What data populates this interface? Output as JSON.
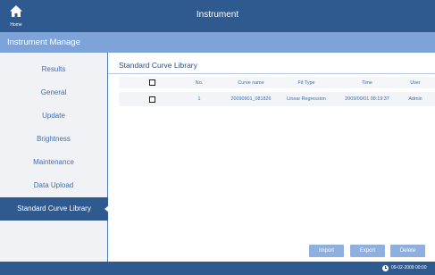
{
  "header": {
    "title": "Instrument",
    "home_label": "Home"
  },
  "section": {
    "title": "Instrument Manage"
  },
  "sidebar": {
    "items": [
      {
        "label": "Results"
      },
      {
        "label": "General"
      },
      {
        "label": "Update"
      },
      {
        "label": "Brightness"
      },
      {
        "label": "Maintenance"
      },
      {
        "label": "Data Upload"
      },
      {
        "label": "Standard Curve Library"
      }
    ],
    "active_index": 6
  },
  "main": {
    "title": "Standard Curve Library",
    "table": {
      "columns": [
        "No.",
        "Curve name",
        "Fit Type",
        "Time",
        "User"
      ],
      "rows": [
        {
          "no": "1",
          "curve_name": "20090901_081826",
          "fit_type": "Linear Regression",
          "time": "2009/09/01 08:19:37",
          "user": "Admin"
        }
      ]
    },
    "buttons": {
      "import": "Import",
      "export": "Export",
      "delete": "Delete"
    }
  },
  "footer": {
    "datetime": "09-02-2009 00:00"
  },
  "colors": {
    "primary": "#2e5a90",
    "secondary": "#7ea3d8",
    "text_accent": "#3d6fb5",
    "button": "#8fb0de"
  }
}
